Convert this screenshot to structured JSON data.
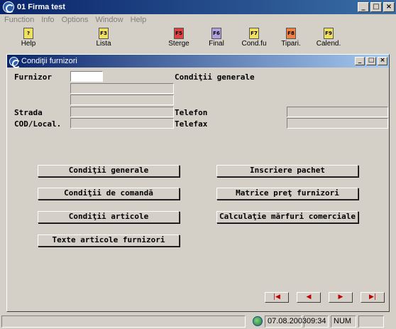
{
  "window": {
    "title": "01   Firma test",
    "min": "_",
    "max": "□",
    "close": "×"
  },
  "menu": [
    "Function",
    "Info",
    "Options",
    "Window",
    "Help"
  ],
  "toolbar": [
    {
      "key": "?",
      "label": "Help",
      "color": "#f0e060"
    },
    {
      "key": "F3",
      "label": "Lista",
      "color": "#f0e060"
    },
    {
      "key": "F5",
      "label": "Sterge",
      "color": "#e04040"
    },
    {
      "key": "F6",
      "label": "Final",
      "color": "#b0a0e0"
    },
    {
      "key": "F7",
      "label": "Cond.fu",
      "color": "#f0e060"
    },
    {
      "key": "F8",
      "label": "Tipari.",
      "color": "#f08040"
    },
    {
      "key": "F9",
      "label": "Calend.",
      "color": "#f0e060"
    }
  ],
  "child": {
    "title": "Condiţii furnizori",
    "labels": {
      "furnizor": "Furnizor",
      "conditii_generale": "Condiţii generale",
      "strada": "Strada",
      "telefon": "Telefon",
      "cod_local": "COD/Local.",
      "telefax": "Telefax"
    },
    "buttons": {
      "conditii_generale": "Condiţii generale",
      "conditii_comanda": "Condiţii de comandă",
      "conditii_articole": "Condiţii articole",
      "texte_articole": "Texte articole furnizori",
      "inscriere_pachet": "Inscriere pachet",
      "matrice_pret": "Matrice preţ furnizori",
      "calculatie": "Calculaţie mărfuri comerciale"
    },
    "nav": {
      "first": "|◀",
      "prev": "◀",
      "next": "▶",
      "last": "▶|"
    }
  },
  "status": {
    "date": "07.08.2003",
    "time": "09:34",
    "num": "NUM"
  }
}
